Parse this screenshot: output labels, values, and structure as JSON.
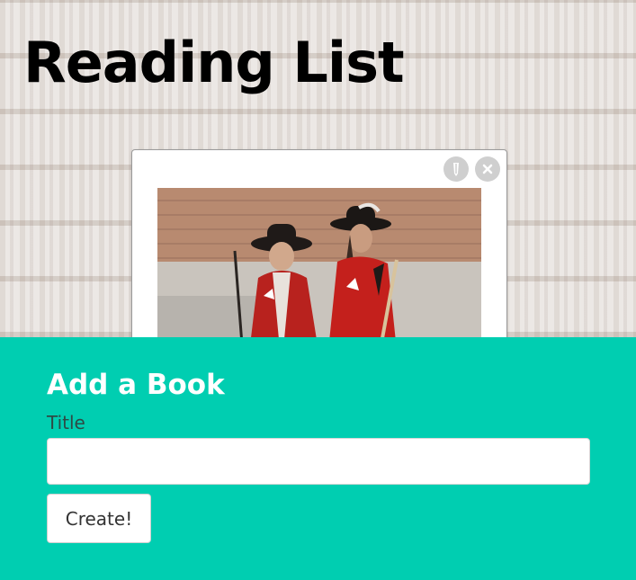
{
  "header": {
    "title": "Reading List"
  },
  "book_card": {
    "edit_icon": "pencil-icon",
    "delete_icon": "close-icon",
    "cover_description": "two-cavaliers-cover-icon"
  },
  "add_form": {
    "heading": "Add a Book",
    "title_label": "Title",
    "title_value": "",
    "title_placeholder": "",
    "submit_label": "Create!"
  },
  "colors": {
    "accent": "#00ceb1",
    "background": "#eeeae7",
    "button_gray": "#cfcfcf"
  }
}
